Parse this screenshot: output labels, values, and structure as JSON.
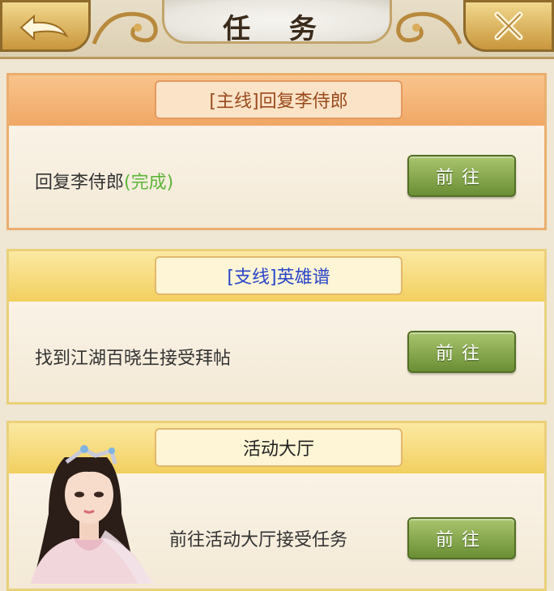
{
  "header": {
    "title": "任 务",
    "back_icon": "back-arrow-icon",
    "close_icon": "close-icon"
  },
  "colors": {
    "main_band": "#f0a764",
    "side_band": "#f2cf5f",
    "button_green": "#6a8e34",
    "done_green": "#5db53a",
    "side_tag_blue": "#2a45c8"
  },
  "main_quest": {
    "tag": "[主线]回复李侍郎",
    "task": "回复李侍郎",
    "status": "(完成)",
    "button": "前往"
  },
  "side_quest": {
    "tag": "[支线]英雄谱",
    "task": "找到江湖百晓生接受拜帖",
    "button": "前往"
  },
  "activity": {
    "tag": "活动大厅",
    "task": "前往活动大厅接受任务",
    "button": "前往"
  }
}
